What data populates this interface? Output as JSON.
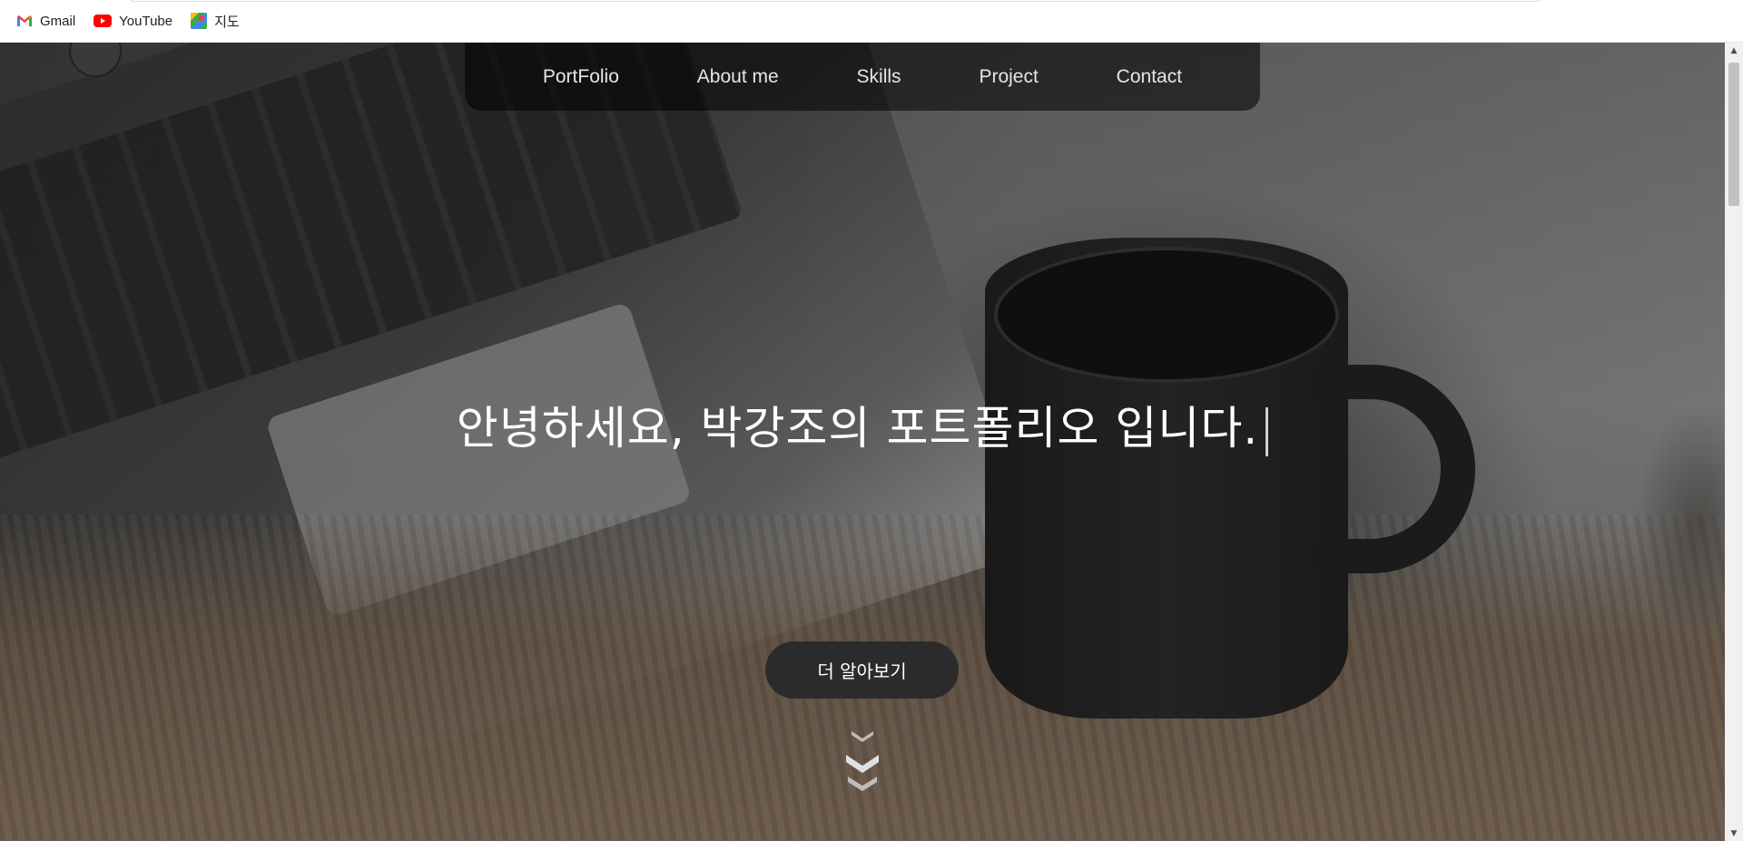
{
  "bookmarks": [
    {
      "label": "Gmail",
      "icon": "gmail-icon"
    },
    {
      "label": "YouTube",
      "icon": "youtube-icon"
    },
    {
      "label": "지도",
      "icon": "maps-icon"
    }
  ],
  "nav": {
    "items": [
      "PortFolio",
      "About me",
      "Skills",
      "Project",
      "Contact"
    ]
  },
  "hero": {
    "title": "안녕하세요, 박강조의 포트폴리오 입니다.",
    "cta_label": "더 알아보기"
  },
  "colors": {
    "nav_bg": "#000000",
    "cta_bg": "#2b2b2b",
    "text": "#ffffff"
  }
}
